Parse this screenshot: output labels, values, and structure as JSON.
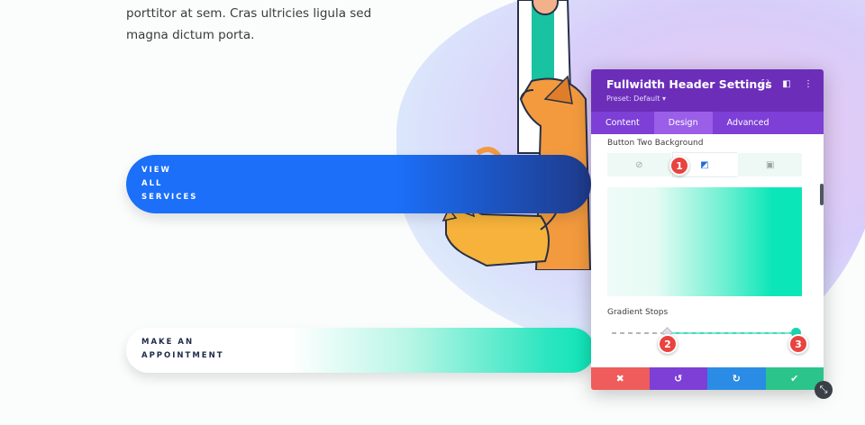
{
  "page": {
    "paragraph": "porttitor at sem. Cras ultricies ligula sed magna dictum porta."
  },
  "buttons": {
    "view_services": [
      "VIEW",
      "ALL",
      "SERVICES"
    ],
    "make_appointment": [
      "MAKE AN",
      "APPOINTMENT"
    ]
  },
  "panel": {
    "title": "Fullwidth Header Settings",
    "preset": "Preset: Default ▾",
    "tabs": [
      "Content",
      "Design",
      "Advanced"
    ],
    "active_tab": "Design",
    "section_label": "Button Two Background",
    "stops_label": "Gradient Stops",
    "bg_type_icons": [
      "paint-bucket-off-icon",
      "gradient-icon",
      "image-icon"
    ],
    "footer_icons": [
      "close-icon",
      "undo-icon",
      "redo-icon",
      "check-icon"
    ],
    "gradient_colors": [
      "#effbf8",
      "#0be6b8"
    ]
  },
  "markers": [
    "1",
    "2",
    "3"
  ],
  "colors": {
    "panel_header": "#6c2eb9",
    "tabs_bar": "#7d3fd6",
    "marker": "#e8433f",
    "button_blue": "#1b6ff9",
    "button_teal": "#0de6b7"
  }
}
